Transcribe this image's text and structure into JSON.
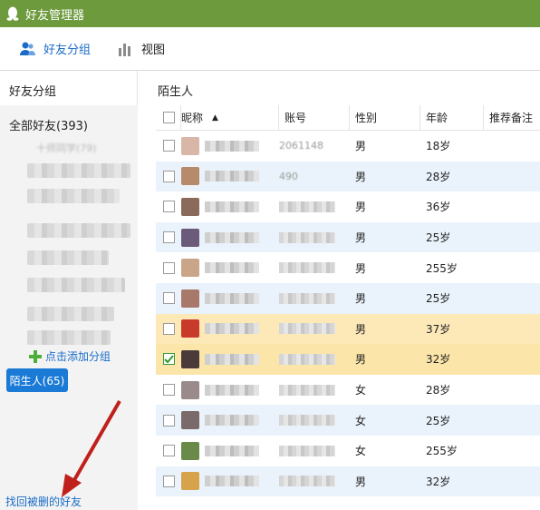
{
  "window": {
    "title": "好友管理器"
  },
  "toolbar": {
    "groups_label": "好友分组",
    "view_label": "视图"
  },
  "sidebar": {
    "title": "好友分组",
    "all_friends": "全部好友(393)",
    "partial_group": "十师同学(79)",
    "add_group": "点击添加分组",
    "stranger": "陌生人(65)",
    "recover": "找回被删的好友"
  },
  "main": {
    "group_title": "陌生人",
    "columns": {
      "nickname": "昵称",
      "account": "账号",
      "gender": "性别",
      "age": "年龄",
      "note": "推荐备注"
    },
    "rows": [
      {
        "account": "2061148",
        "gender": "男",
        "age": "18岁",
        "checked": false,
        "style": "normal"
      },
      {
        "account": "490",
        "gender": "男",
        "age": "28岁",
        "checked": false,
        "style": "alt"
      },
      {
        "account": "",
        "gender": "男",
        "age": "36岁",
        "checked": false,
        "style": "normal"
      },
      {
        "account": "",
        "gender": "男",
        "age": "25岁",
        "checked": false,
        "style": "alt"
      },
      {
        "account": "",
        "gender": "男",
        "age": "255岁",
        "checked": false,
        "style": "normal"
      },
      {
        "account": "",
        "gender": "男",
        "age": "25岁",
        "checked": false,
        "style": "alt"
      },
      {
        "account": "",
        "gender": "男",
        "age": "37岁",
        "checked": false,
        "style": "hl1"
      },
      {
        "account": "",
        "gender": "男",
        "age": "32岁",
        "checked": true,
        "style": "hl2"
      },
      {
        "account": "",
        "gender": "女",
        "age": "28岁",
        "checked": false,
        "style": "normal"
      },
      {
        "account": "",
        "gender": "女",
        "age": "25岁",
        "checked": false,
        "style": "alt"
      },
      {
        "account": "",
        "gender": "女",
        "age": "255岁",
        "checked": false,
        "style": "normal"
      },
      {
        "account": "",
        "gender": "男",
        "age": "32岁",
        "checked": false,
        "style": "alt"
      }
    ]
  },
  "colors": {
    "titlebar": "#6c9a3c",
    "accent": "#1a6cc8",
    "selected_group": "#1a7ad6",
    "arrow": "#c0201c"
  }
}
